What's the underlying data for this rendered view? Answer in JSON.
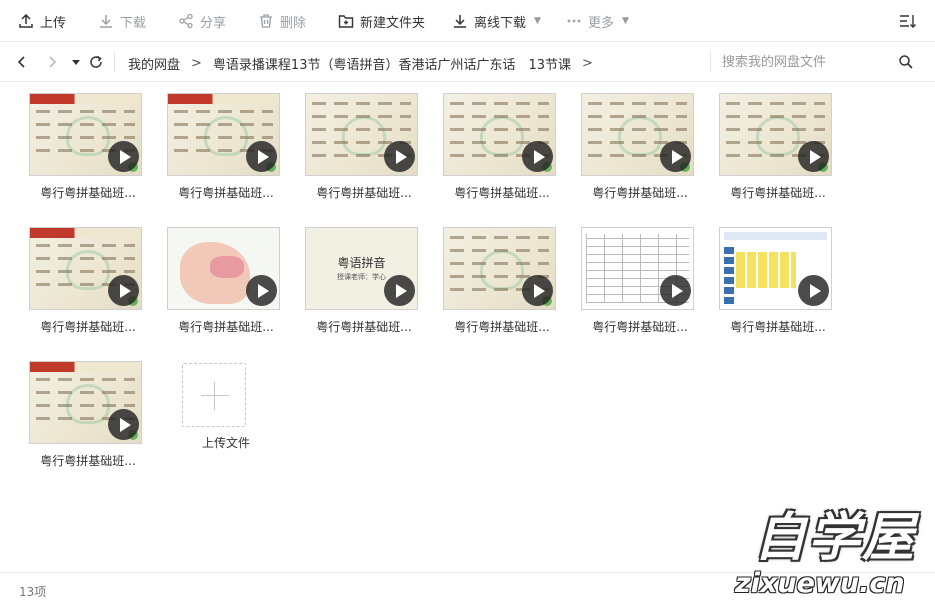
{
  "toolbar": {
    "upload": "上传",
    "download": "下载",
    "share": "分享",
    "delete": "删除",
    "new_folder": "新建文件夹",
    "offline_download": "离线下载",
    "more": "更多"
  },
  "breadcrumb": {
    "root": "我的网盘",
    "folder": "粤语录播课程13节（粤语拼音）香港话广州话广东话　13节课"
  },
  "search": {
    "placeholder": "搜索我的网盘文件"
  },
  "files": [
    {
      "name": "粤行粤拼基础班..."
    },
    {
      "name": "粤行粤拼基础班..."
    },
    {
      "name": "粤行粤拼基础班..."
    },
    {
      "name": "粤行粤拼基础班..."
    },
    {
      "name": "粤行粤拼基础班..."
    },
    {
      "name": "粤行粤拼基础班..."
    },
    {
      "name": "粤行粤拼基础班..."
    },
    {
      "name": "粤行粤拼基础班..."
    },
    {
      "name": "粤行粤拼基础班..."
    },
    {
      "name": "粤行粤拼基础班..."
    },
    {
      "name": "粤行粤拼基础班..."
    },
    {
      "name": "粤行粤拼基础班..."
    },
    {
      "name": "粤行粤拼基础班..."
    }
  ],
  "thumb_text": {
    "title_big": "粤语拼音",
    "title_sub": "授课老师：学心"
  },
  "upload_tile": {
    "label": "上传文件"
  },
  "status": {
    "count": "13项"
  },
  "watermark": {
    "main": "自学屋",
    "sub": "zixuewu.cn"
  }
}
